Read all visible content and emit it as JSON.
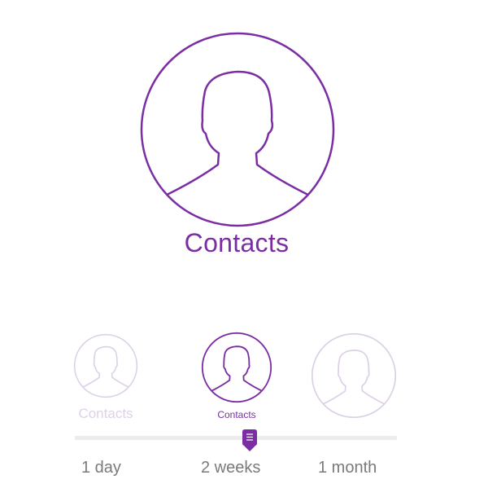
{
  "hero": {
    "label": "Contacts",
    "icon": "contact-avatar-icon",
    "color": "#7b2ea3"
  },
  "options": [
    {
      "label": "Contacts",
      "icon": "contact-avatar-icon",
      "state": "faded"
    },
    {
      "label": "Contacts",
      "icon": "contact-avatar-icon",
      "state": "selected"
    },
    {
      "label": "",
      "icon": "contact-avatar-icon",
      "state": "faded"
    }
  ],
  "slider": {
    "ticks": [
      "1 day",
      "2 weeks",
      "1 month"
    ],
    "selected_index": 1,
    "selected_value": "2 weeks",
    "thumb_icon": "slider-thumb-icon",
    "colors": {
      "accent": "#7b2ea3",
      "faded": "#ddd1e8",
      "track": "#ececec",
      "tick_text": "#7a7a7a"
    }
  }
}
